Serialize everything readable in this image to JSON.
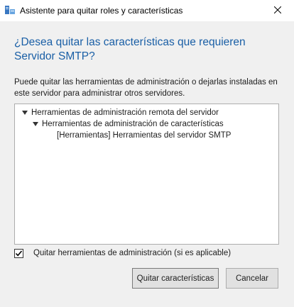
{
  "window": {
    "title": "Asistente para quitar roles y características",
    "icon": "server-manager-icon",
    "close_icon": "close-icon"
  },
  "dialog": {
    "heading": "¿Desea quitar las características que requieren Servidor SMTP?",
    "description": "Puede quitar las herramientas de administración o dejarlas instaladas en este servidor para administrar otros servidores.",
    "tree": [
      {
        "label": "Herramientas de administración remota del servidor",
        "level": 0,
        "expanded": true
      },
      {
        "label": "Herramientas de administración de características",
        "level": 1,
        "expanded": true
      },
      {
        "label": "[Herramientas] Herramientas del servidor SMTP",
        "level": 2,
        "expanded": false
      }
    ],
    "checkbox": {
      "label": "Quitar herramientas de administración (si es aplicable)",
      "checked": true
    },
    "buttons": {
      "remove": "Quitar características",
      "cancel": "Cancelar"
    }
  },
  "colors": {
    "heading": "#1a5fa6",
    "background": "#f0f0f0"
  }
}
